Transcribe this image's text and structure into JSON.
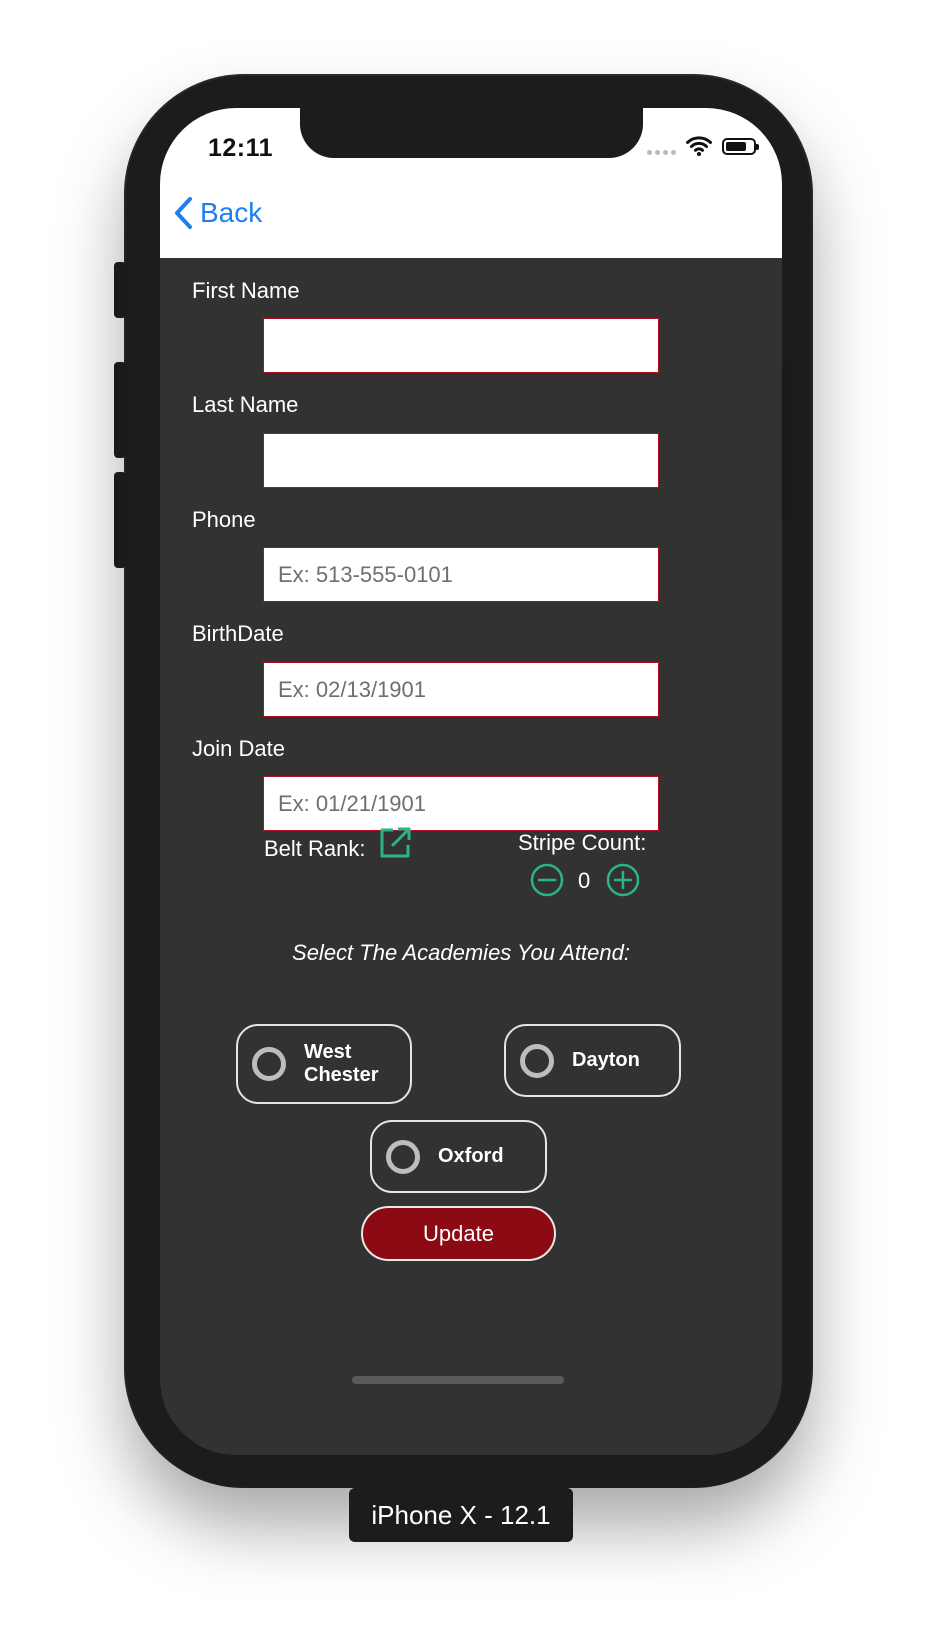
{
  "status_bar": {
    "time": "12:11"
  },
  "nav": {
    "back_label": "Back"
  },
  "form": {
    "first_name": {
      "label": "First Name",
      "value": "",
      "placeholder": ""
    },
    "last_name": {
      "label": "Last Name",
      "value": "",
      "placeholder": ""
    },
    "phone": {
      "label": "Phone",
      "value": "",
      "placeholder": "Ex: 513-555-0101"
    },
    "birth_date": {
      "label": "BirthDate",
      "value": "",
      "placeholder": "Ex: 02/13/1901"
    },
    "join_date": {
      "label": "Join Date",
      "value": "",
      "placeholder": "Ex: 01/21/1901"
    },
    "belt_rank_label": "Belt Rank:",
    "stripe_count": {
      "label": "Stripe Count:",
      "value": "0"
    }
  },
  "academies": {
    "title": "Select The Academies You Attend:",
    "items": [
      {
        "line1": "West",
        "line2": "Chester",
        "selected": false
      },
      {
        "line1": "Dayton",
        "line2": "",
        "selected": false
      },
      {
        "line1": "Oxford",
        "line2": "",
        "selected": false
      }
    ]
  },
  "update_label": "Update",
  "device_caption": "iPhone X - 12.1",
  "colors": {
    "background": "#323232",
    "accent_blue": "#1f7ef0",
    "accent_green": "#2bb38a",
    "field_border": "#b30f20",
    "update_button": "#8b0a14"
  },
  "icons": [
    "wifi-icon",
    "battery-icon",
    "chevron-left-icon",
    "external-link-icon",
    "minus-circle-icon",
    "plus-circle-icon",
    "radio-icon"
  ]
}
